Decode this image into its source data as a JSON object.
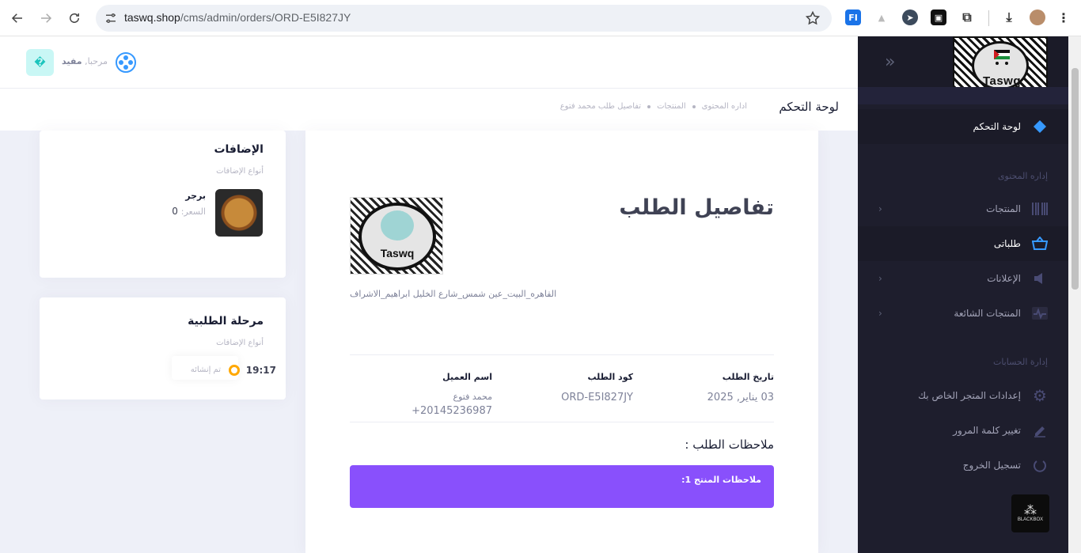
{
  "browser": {
    "url_host": "taswq.shop",
    "url_path": "/cms/admin/orders/ORD-E5I827JY"
  },
  "header": {
    "greeting": "مرحبا,",
    "user_name": "مفيد",
    "avatar_letter": "�"
  },
  "subheader": {
    "title": "لوحة التحكم",
    "breadcrumbs": [
      "اداره المحتوى",
      "المنتجات",
      "تفاصيل طلب محمد فتوع"
    ]
  },
  "sidebar": {
    "brand": "Taswq",
    "items": [
      {
        "label": "لوحة التحكم",
        "icon": "diamond-icon",
        "active": true
      },
      {
        "label": "المنتجات",
        "icon": "barcode-icon",
        "chevron": true
      },
      {
        "label": "طلباتى",
        "icon": "basket-icon",
        "active": false
      },
      {
        "label": "الإعلانات",
        "icon": "speaker-icon",
        "chevron": true
      },
      {
        "label": "المنتجات الشائعة",
        "icon": "pulse-icon",
        "chevron": true
      },
      {
        "label": "إعدادات المتجر الخاص بك",
        "icon": "gear-icon"
      },
      {
        "label": "تغيير كلمة المرور",
        "icon": "pencil-icon"
      },
      {
        "label": "تسجيل الخروج",
        "icon": "power-icon"
      }
    ],
    "sections": [
      "إداره المحتوى",
      "إدارة الحسابات"
    ],
    "footer_badge": "BLACKBOX"
  },
  "order": {
    "title": "تفاصيل الطلب",
    "brand": "Taswq",
    "address": "القاهره_البيت_عين شمس_شارع الخليل ابراهيم_الاشراف",
    "date_label": "تاريخ الطلب",
    "date_value": "03 يناير, 2025",
    "code_label": "كود الطلب",
    "code_value": "ORD-E5I827JY",
    "customer_label": "اسم العميل",
    "customer_name": "محمد فتوع",
    "customer_phone": "+20145236987",
    "notes_title": "ملاحظات الطلب :",
    "product_note": "ملاحظات المنتج 1:"
  },
  "addons_card": {
    "title": "الإضافات",
    "subtitle": "أنواع الإضافات",
    "product_name": "برجر",
    "price_label": "السعر:",
    "price_value": "0"
  },
  "stage_card": {
    "title": "مرحلة الطلبية",
    "subtitle": "أنواع الإضافات",
    "time": "19:17",
    "status": "تم إنشائه",
    "status_color": "#ffa800"
  },
  "colors": {
    "sidebar_bg": "#1e1e2d",
    "accent": "#3699ff",
    "notes_bg": "#8950fc"
  }
}
